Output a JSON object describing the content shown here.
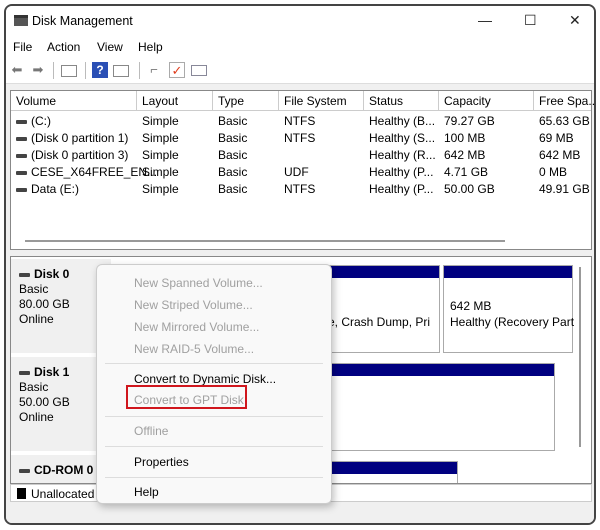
{
  "window": {
    "title": "Disk Management",
    "controls": {
      "minimize": "—",
      "maximize": "☐",
      "close": "✕"
    }
  },
  "menubar": [
    "File",
    "Action",
    "View",
    "Help"
  ],
  "toolbar": {
    "icons": [
      "back-arrow-icon",
      "forward-arrow-icon",
      "console-tree-icon",
      "help-icon",
      "show-pane-icon",
      "rescan-icon",
      "check-icon",
      "properties-icon"
    ]
  },
  "volume_list": {
    "columns": [
      "Volume",
      "Layout",
      "Type",
      "File System",
      "Status",
      "Capacity",
      "Free Spa..."
    ],
    "rows": [
      [
        "(C:)",
        "Simple",
        "Basic",
        "NTFS",
        "Healthy (B...",
        "79.27 GB",
        "65.63 GB"
      ],
      [
        "(Disk 0 partition 1)",
        "Simple",
        "Basic",
        "NTFS",
        "Healthy (S...",
        "100 MB",
        "69 MB"
      ],
      [
        "(Disk 0 partition 3)",
        "Simple",
        "Basic",
        "",
        "Healthy (R...",
        "642 MB",
        "642 MB"
      ],
      [
        "CESE_X64FREE_EN...",
        "Simple",
        "Basic",
        "UDF",
        "Healthy (P...",
        "4.71 GB",
        "0 MB"
      ],
      [
        "Data (E:)",
        "Simple",
        "Basic",
        "NTFS",
        "Healthy (P...",
        "50.00 GB",
        "49.91 GB"
      ]
    ]
  },
  "disks": [
    {
      "name": "Disk 0",
      "type": "Basic",
      "size": "80.00 GB",
      "state": "Online",
      "partitions": [
        {
          "line1": "",
          "line2": ""
        },
        {
          "line1": "",
          "line2": "e, Crash Dump, Pri"
        },
        {
          "line1": "642 MB",
          "line2": "Healthy (Recovery Part"
        }
      ]
    },
    {
      "name": "Disk 1",
      "type": "Basic",
      "size": "50.00 GB",
      "state": "Online"
    },
    {
      "name": "CD-ROM 0"
    }
  ],
  "legend": {
    "unallocated": "Unallocated"
  },
  "context_menu": {
    "items": [
      {
        "label": "New Spanned Volume...",
        "enabled": false
      },
      {
        "label": "New Striped Volume...",
        "enabled": false
      },
      {
        "label": "New Mirrored Volume...",
        "enabled": false
      },
      {
        "label": "New RAID-5 Volume...",
        "enabled": false
      },
      {
        "label": "Convert to Dynamic Disk...",
        "enabled": true
      },
      {
        "label": "Convert to GPT Disk",
        "enabled": false
      },
      {
        "label": "Offline",
        "enabled": false
      },
      {
        "label": "Properties",
        "enabled": true
      },
      {
        "label": "Help",
        "enabled": true
      }
    ],
    "highlight_color": "#d0161d"
  }
}
